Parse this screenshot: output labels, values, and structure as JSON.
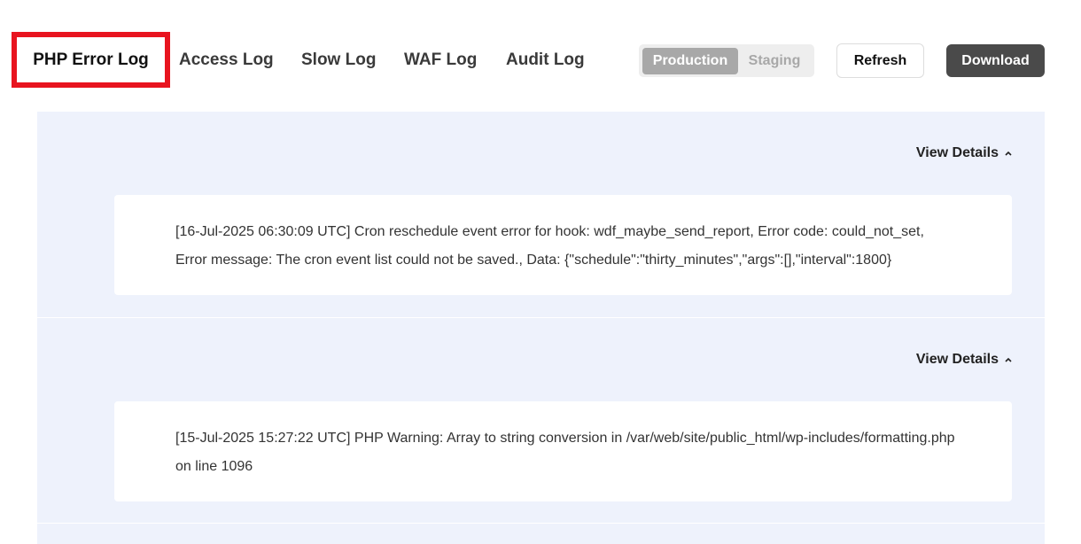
{
  "tabs": [
    {
      "label": "PHP Error Log",
      "active": true
    },
    {
      "label": "Access Log",
      "active": false
    },
    {
      "label": "Slow Log",
      "active": false
    },
    {
      "label": "WAF Log",
      "active": false
    },
    {
      "label": "Audit Log",
      "active": false
    }
  ],
  "environment": {
    "options": [
      "Production",
      "Staging"
    ],
    "selected": "Production"
  },
  "actions": {
    "refresh_label": "Refresh",
    "download_label": "Download"
  },
  "logs": [
    {
      "view_details_label": "View Details",
      "message": "[16-Jul-2025 06:30:09 UTC] Cron reschedule event error for hook: wdf_maybe_send_report, Error code: could_not_set, Error message: The cron event list could not be saved., Data: {\"schedule\":\"thirty_minutes\",\"args\":[],\"interval\":1800}"
    },
    {
      "view_details_label": "View Details",
      "message": "[15-Jul-2025 15:27:22 UTC] PHP Warning: Array to string conversion in /var/web/site/public_html/wp-includes/formatting.php on line 1096"
    }
  ],
  "colors": {
    "highlight": "#e8141f",
    "log_bg": "#eef2fc",
    "download_bg": "#4a4a4a",
    "toggle_active": "#a8a8a8"
  }
}
